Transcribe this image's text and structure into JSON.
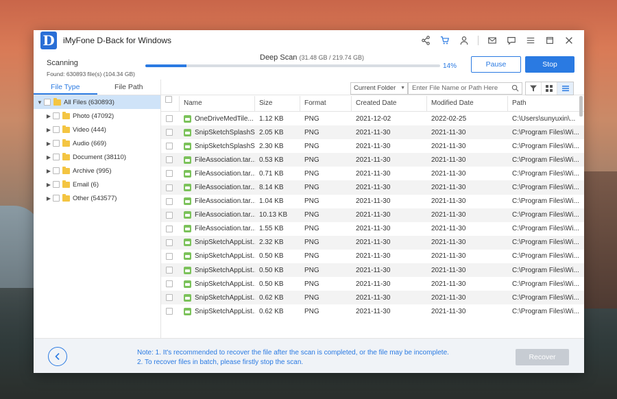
{
  "app": {
    "logo_letter": "D",
    "title": "iMyFone D-Back for Windows"
  },
  "scan": {
    "status": "Scanning",
    "found": "Found: 630893 file(s) (104.34 GB)",
    "mode": "Deep Scan",
    "size": "(31.48 GB / 219.74 GB)",
    "progress_percent": 14,
    "progress_label": "14%",
    "pause_label": "Pause",
    "stop_label": "Stop"
  },
  "tabs": [
    {
      "label": "File Type",
      "active": true
    },
    {
      "label": "File Path",
      "active": false
    }
  ],
  "tree": [
    {
      "label": "All Files (630893)",
      "expanded": true,
      "selected": true,
      "indent": 0
    },
    {
      "label": "Photo (47092)",
      "expanded": false,
      "selected": false,
      "indent": 1
    },
    {
      "label": "Video (444)",
      "expanded": false,
      "selected": false,
      "indent": 1
    },
    {
      "label": "Audio (669)",
      "expanded": false,
      "selected": false,
      "indent": 1
    },
    {
      "label": "Document (38110)",
      "expanded": false,
      "selected": false,
      "indent": 1
    },
    {
      "label": "Archive (995)",
      "expanded": false,
      "selected": false,
      "indent": 1
    },
    {
      "label": "Email (6)",
      "expanded": false,
      "selected": false,
      "indent": 1
    },
    {
      "label": "Other (543577)",
      "expanded": false,
      "selected": false,
      "indent": 1
    }
  ],
  "toolbar": {
    "folder_select": "Current Folder",
    "search_placeholder": "Enter File Name or Path Here"
  },
  "table": {
    "columns": [
      "Name",
      "Size",
      "Format",
      "Created Date",
      "Modified Date",
      "Path"
    ],
    "rows": [
      {
        "name": "OneDriveMedTile...",
        "size": "1.12 KB",
        "format": "PNG",
        "created": "2021-12-02",
        "modified": "2022-02-25",
        "path": "C:\\Users\\sunyuxin\\..."
      },
      {
        "name": "SnipSketchSplashS...",
        "size": "2.05 KB",
        "format": "PNG",
        "created": "2021-11-30",
        "modified": "2021-11-30",
        "path": "C:\\Program Files\\Wi..."
      },
      {
        "name": "SnipSketchSplashS...",
        "size": "2.30 KB",
        "format": "PNG",
        "created": "2021-11-30",
        "modified": "2021-11-30",
        "path": "C:\\Program Files\\Wi..."
      },
      {
        "name": "FileAssociation.tar...",
        "size": "0.53 KB",
        "format": "PNG",
        "created": "2021-11-30",
        "modified": "2021-11-30",
        "path": "C:\\Program Files\\Wi..."
      },
      {
        "name": "FileAssociation.tar...",
        "size": "0.71 KB",
        "format": "PNG",
        "created": "2021-11-30",
        "modified": "2021-11-30",
        "path": "C:\\Program Files\\Wi..."
      },
      {
        "name": "FileAssociation.tar...",
        "size": "8.14 KB",
        "format": "PNG",
        "created": "2021-11-30",
        "modified": "2021-11-30",
        "path": "C:\\Program Files\\Wi..."
      },
      {
        "name": "FileAssociation.tar...",
        "size": "1.04 KB",
        "format": "PNG",
        "created": "2021-11-30",
        "modified": "2021-11-30",
        "path": "C:\\Program Files\\Wi..."
      },
      {
        "name": "FileAssociation.tar...",
        "size": "10.13 KB",
        "format": "PNG",
        "created": "2021-11-30",
        "modified": "2021-11-30",
        "path": "C:\\Program Files\\Wi..."
      },
      {
        "name": "FileAssociation.tar...",
        "size": "1.55 KB",
        "format": "PNG",
        "created": "2021-11-30",
        "modified": "2021-11-30",
        "path": "C:\\Program Files\\Wi..."
      },
      {
        "name": "SnipSketchAppList...",
        "size": "2.32 KB",
        "format": "PNG",
        "created": "2021-11-30",
        "modified": "2021-11-30",
        "path": "C:\\Program Files\\Wi..."
      },
      {
        "name": "SnipSketchAppList...",
        "size": "0.50 KB",
        "format": "PNG",
        "created": "2021-11-30",
        "modified": "2021-11-30",
        "path": "C:\\Program Files\\Wi..."
      },
      {
        "name": "SnipSketchAppList...",
        "size": "0.50 KB",
        "format": "PNG",
        "created": "2021-11-30",
        "modified": "2021-11-30",
        "path": "C:\\Program Files\\Wi..."
      },
      {
        "name": "SnipSketchAppList...",
        "size": "0.50 KB",
        "format": "PNG",
        "created": "2021-11-30",
        "modified": "2021-11-30",
        "path": "C:\\Program Files\\Wi..."
      },
      {
        "name": "SnipSketchAppList...",
        "size": "0.62 KB",
        "format": "PNG",
        "created": "2021-11-30",
        "modified": "2021-11-30",
        "path": "C:\\Program Files\\Wi..."
      },
      {
        "name": "SnipSketchAppList...",
        "size": "0.62 KB",
        "format": "PNG",
        "created": "2021-11-30",
        "modified": "2021-11-30",
        "path": "C:\\Program Files\\Wi..."
      }
    ]
  },
  "footer": {
    "note_line1": "Note: 1. It's recommended to recover the file after the scan is completed, or the file may be incomplete.",
    "note_line2": "2. To recover files in batch, please firstly stop the scan.",
    "recover_label": "Recover"
  },
  "icons": {
    "share": "share-icon",
    "cart": "cart-icon",
    "user": "user-icon",
    "mail": "mail-icon",
    "chat": "chat-icon",
    "menu": "menu-icon",
    "maximize": "maximize-icon",
    "close": "close-icon"
  },
  "colors": {
    "accent": "#2a7ae2",
    "folder": "#f4c542",
    "png": "#7bc25a",
    "disabled": "#c7ccd3"
  }
}
